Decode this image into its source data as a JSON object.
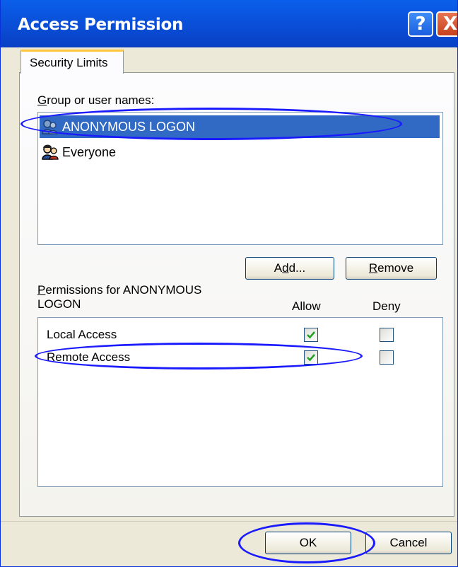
{
  "window": {
    "title": "Access Permission",
    "help_label": "?",
    "close_label": "X"
  },
  "tabs": [
    {
      "label": "Security Limits",
      "selected": true
    }
  ],
  "groups": {
    "label_prefix": "G",
    "label_rest": "roup or user names:",
    "items": [
      {
        "name": "ANONYMOUS LOGON",
        "icon": "user-group-icon",
        "selected": true
      },
      {
        "name": "Everyone",
        "icon": "user-group-icon",
        "selected": false
      }
    ]
  },
  "buttons": {
    "add_pre": "A",
    "add_u": "d",
    "add_post": "d...",
    "remove_u": "R",
    "remove_rest": "emove",
    "ok": "OK",
    "cancel": "Cancel"
  },
  "permissions": {
    "label_u": "P",
    "label_line1_rest": "ermissions for ANONYMOUS",
    "label_line2": "LOGON",
    "allow_header": "Allow",
    "deny_header": "Deny",
    "rows": [
      {
        "name": "Local Access",
        "allow": true,
        "deny": false
      },
      {
        "name": "Remote Access",
        "allow": true,
        "deny": false
      }
    ]
  },
  "colors": {
    "titlebar": "#0a4fd8",
    "selection": "#316ac5",
    "annotation": "#1a1aff"
  }
}
